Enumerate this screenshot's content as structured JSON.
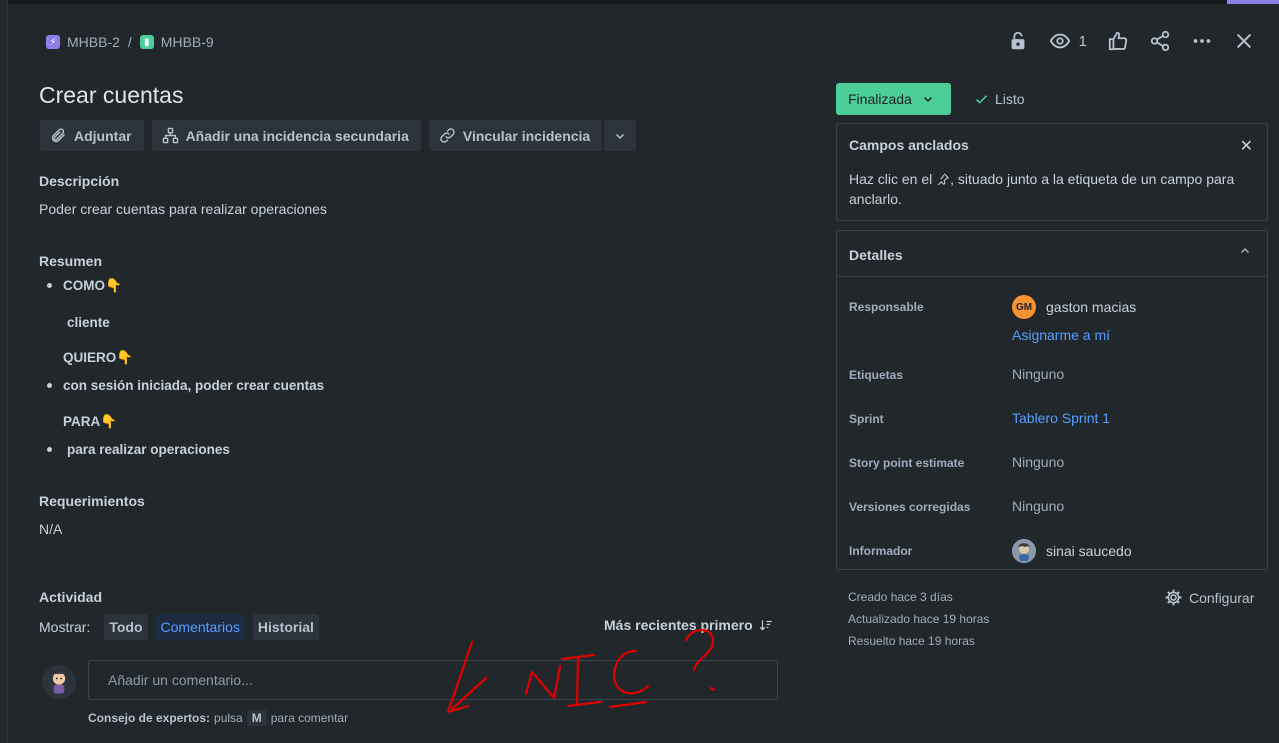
{
  "breadcrumb": {
    "parent_key": "MHBB-2",
    "separator": "/",
    "issue_key": "MHBB-9"
  },
  "header_actions": {
    "watchers_count": "1"
  },
  "issue": {
    "title": "Crear cuentas"
  },
  "toolbar": {
    "attach_label": "Adjuntar",
    "child_label": "Añadir una incidencia secundaria",
    "link_label": "Vincular incidencia"
  },
  "description": {
    "label": "Descripción",
    "text": "Poder crear cuentas para realizar operaciones"
  },
  "summary": {
    "label": "Resumen",
    "lines": [
      "COMO",
      "cliente",
      "QUIERO",
      "con sesión iniciada, poder crear cuentas",
      "PARA",
      "para realizar operaciones"
    ],
    "pointer_emoji": "👇"
  },
  "requirements": {
    "label": "Requerimientos",
    "text": "N/A"
  },
  "activity": {
    "label": "Actividad",
    "show_label": "Mostrar:",
    "filters": [
      "Todo",
      "Comentarios",
      "Historial"
    ],
    "selected_filter": "Comentarios",
    "sort_label": "Más recientes primero",
    "comment_placeholder": "Añadir un comentario...",
    "tip_prefix": "Consejo de expertos:",
    "tip_middle": "pulsa",
    "tip_key": "M",
    "tip_suffix": "para comentar"
  },
  "status": {
    "label": "Finalizada",
    "color": "#4bce97",
    "resolution": "Listo"
  },
  "pinned_fields": {
    "title": "Campos anclados",
    "text_before": "Haz clic en el",
    "text_after": ", situado junto a la etiqueta de un campo para anclarlo."
  },
  "details": {
    "title": "Detalles",
    "fields": {
      "assignee": {
        "label": "Responsable",
        "initials": "GM",
        "name": "gaston macias",
        "assign_me": "Asignarme a mí"
      },
      "labels": {
        "label": "Etiquetas",
        "value": "Ninguno"
      },
      "sprint": {
        "label": "Sprint",
        "value": "Tablero Sprint 1"
      },
      "story_points": {
        "label": "Story point estimate",
        "value": "Ninguno"
      },
      "fix_versions": {
        "label": "Versiones corregidas",
        "value": "Ninguno"
      },
      "reporter": {
        "label": "Informador",
        "name": "sinai saucedo"
      }
    }
  },
  "meta": {
    "created": "Creado hace 3 días",
    "updated": "Actualizado hace 19 horas",
    "resolved": "Resuelto hace 19 horas",
    "configure_label": "Configurar"
  }
}
